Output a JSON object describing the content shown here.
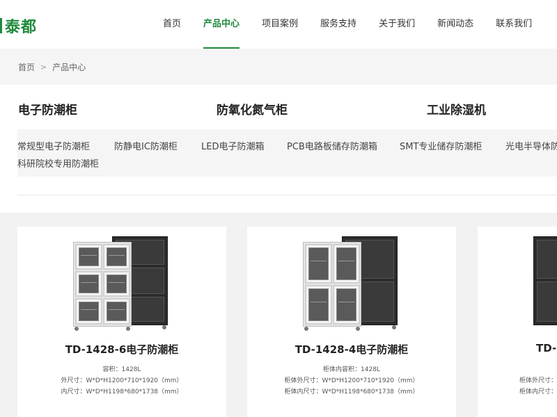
{
  "brand": {
    "logo_text": "泰都"
  },
  "nav": [
    {
      "label": "首页"
    },
    {
      "label": "产品中心",
      "active": true
    },
    {
      "label": "项目案例"
    },
    {
      "label": "服务支持"
    },
    {
      "label": "关于我们"
    },
    {
      "label": "新闻动态"
    },
    {
      "label": "联系我们"
    }
  ],
  "breadcrumb": {
    "home": "首页",
    "separator": ">",
    "current": "产品中心"
  },
  "categories": {
    "titles": [
      "电子防潮柜",
      "防氧化氮气柜",
      "工业除湿机"
    ],
    "subs": [
      "常规型电子防潮柜",
      "防静电IC防潮柜",
      "LED电子防潮箱",
      "PCB电路板储存防潮箱",
      "SMT专业储存防潮柜",
      "光电半导体防",
      "科研院校专用防潮柜"
    ]
  },
  "products": [
    {
      "title": "TD-1428-6电子防潮柜",
      "specs": [
        "容积：1428L",
        "外尺寸：W*D*H1200*710*1920（mm）",
        "内尺寸：W*D*H1198*680*1738（mm）"
      ]
    },
    {
      "title": "TD-1428-4电子防潮柜",
      "specs": [
        "柜体内容积：1428L",
        "柜体外尺寸：W*D*H1200*710*1920（mm）",
        "柜体内尺寸：W*D*H1198*680*1738（mm）"
      ]
    },
    {
      "title": "TD-",
      "specs": [
        "柜体外尺寸：",
        "柜体内尺寸："
      ]
    }
  ],
  "colors": {
    "accent": "#1f8a3c",
    "band_bg": "#f5f5f5",
    "product_bg": "#f2f2f2"
  }
}
